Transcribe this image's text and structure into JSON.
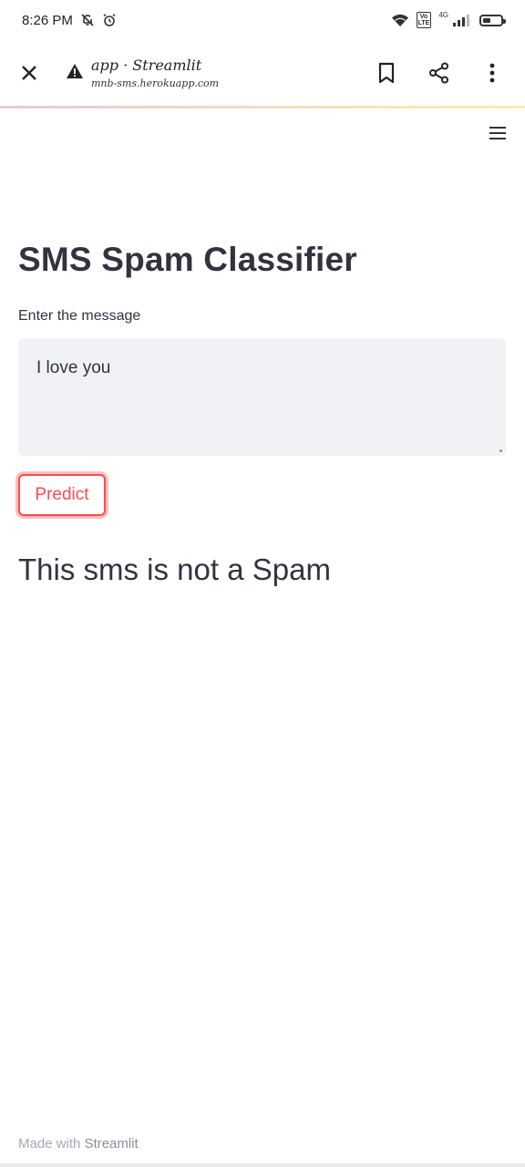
{
  "status_bar": {
    "time": "8:26 PM",
    "icons": [
      "bell-off-icon",
      "alarm-icon",
      "wifi-icon",
      "volte-icon",
      "signal-icon",
      "battery-icon"
    ],
    "volte_label": "Vo\nLTE",
    "network_label": "4G",
    "battery_level": 0.45
  },
  "browser": {
    "page_title": "app · Streamlit",
    "url": "mnb-sms.herokuapp.com",
    "icons": [
      "close-icon",
      "warning-icon",
      "bookmark-icon",
      "share-icon",
      "more-vertical-icon"
    ]
  },
  "app": {
    "menu_icon": "hamburger-menu-icon",
    "title": "SMS Spam Classifier",
    "input_label": "Enter the message",
    "input_value": "I love you",
    "button_label": "Predict",
    "result": "This sms is not a Spam",
    "footer_prefix": "Made with ",
    "footer_link": "Streamlit"
  },
  "colors": {
    "accent": "#ff4b4b",
    "text": "#31333f",
    "input_bg": "#f0f2f6"
  }
}
